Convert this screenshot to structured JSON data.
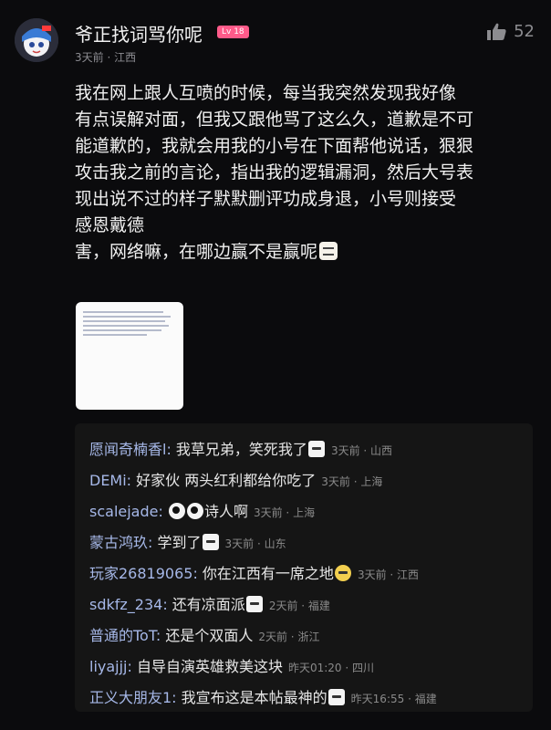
{
  "post": {
    "username": "爷正找词骂你呢",
    "level_badge": "Lv 18",
    "meta": "3天前 · 江西",
    "like_count": "52",
    "body_lines": [
      "我在网上跟人互喷的时候，每当我突然发现我好像",
      "有点误解对面，但我又跟他骂了这么久，道歉是不可",
      "能道歉的，我就会用我的小号在下面帮他说话，狠狠",
      "攻击我之前的言论，指出我的逻辑漏洞，然后大号表",
      "现出说不过的样子默默删评功成身退，小号则接受",
      "感恩戴德",
      "害，网络嘛，在哪边赢不是赢呢"
    ]
  },
  "comments": [
    {
      "name": "愿闻奇楠香l:",
      "text": " 我草兄弟，笑死我了",
      "time": "3天前 · 山西"
    },
    {
      "name": "DEMi:",
      "text": " 好家伙 两头红利都给你吃了",
      "time": "3天前 · 上海"
    },
    {
      "name": "scalejade:",
      "text": "诗人啊",
      "time": "3天前 · 上海"
    },
    {
      "name": "蒙古鸿玖:",
      "text": " 学到了",
      "time": "3天前 · 山东"
    },
    {
      "name": "玩家26819065:",
      "text": " 你在江西有一席之地",
      "time": "3天前 · 江西"
    },
    {
      "name": "sdkfz_234:",
      "text": " 还有凉面派",
      "time": "2天前 · 福建"
    },
    {
      "name": "普通的ToT:",
      "text": " 还是个双面人",
      "time": "2天前 · 浙江"
    },
    {
      "name": "liyajjj:",
      "text": " 自导自演英雄救美这块",
      "time": "昨天01:20 · 四川"
    },
    {
      "name": "正义大朋友1:",
      "text": " 我宣布这是本帖最神的",
      "time": "昨天16:55 · 福建"
    }
  ],
  "icons": {
    "like": "thumbs-up-icon",
    "avatar": "anime-avatar"
  },
  "colors": {
    "background": "#0b0b0d",
    "comment_name": "#a6b8e8",
    "badge": "#ff5b8a",
    "meta": "#8d8d92"
  }
}
